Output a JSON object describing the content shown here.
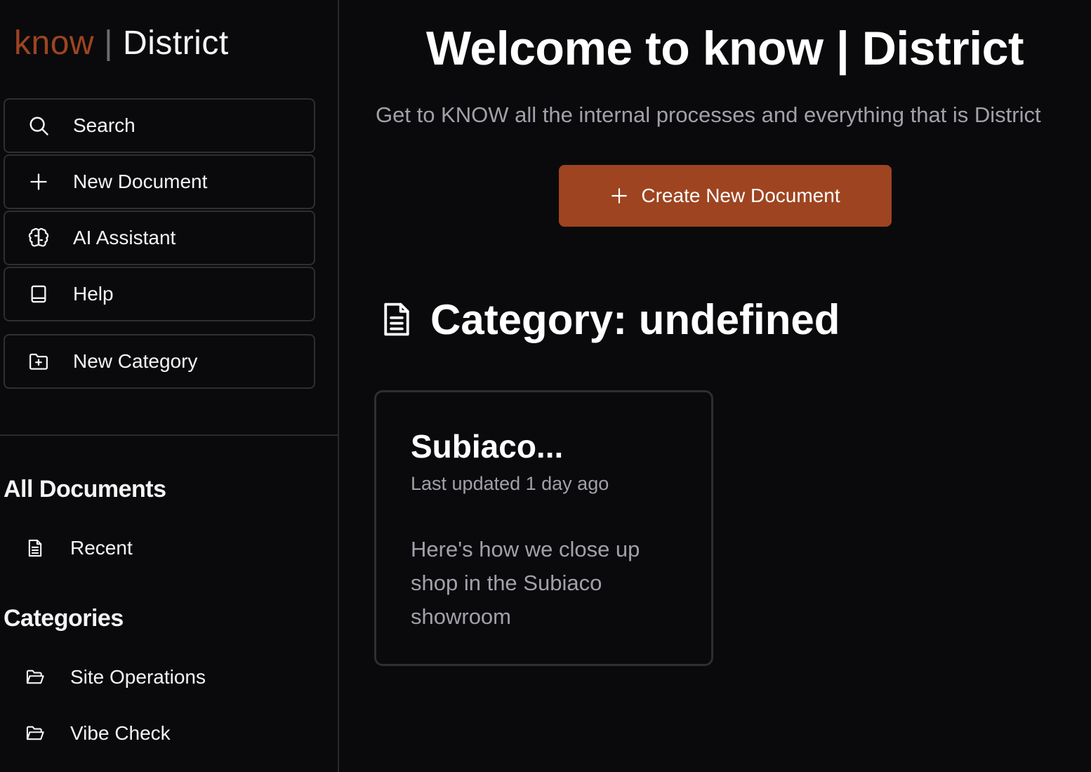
{
  "brand": {
    "know": "know",
    "separator": "|",
    "name": "District",
    "accent_color": "#9e4420"
  },
  "sidebar": {
    "actions": [
      {
        "label": "Search",
        "icon": "search-icon"
      },
      {
        "label": "New Document",
        "icon": "plus-icon"
      },
      {
        "label": "AI Assistant",
        "icon": "brain-icon"
      },
      {
        "label": "Help",
        "icon": "book-icon"
      },
      {
        "label": "New Category",
        "icon": "folder-plus-icon"
      }
    ],
    "all_documents": {
      "title": "All Documents",
      "items": [
        {
          "label": "Recent",
          "icon": "document-icon"
        }
      ]
    },
    "categories": {
      "title": "Categories",
      "items": [
        {
          "label": "Site Operations",
          "icon": "folder-open-icon"
        },
        {
          "label": "Vibe Check",
          "icon": "folder-open-icon"
        }
      ]
    }
  },
  "main": {
    "welcome": "Welcome to know | District",
    "subtitle": "Get to KNOW all the internal processes and everything that is District",
    "create_button": {
      "label": "Create New Document",
      "icon": "plus-icon"
    },
    "category_heading": "Category: undefined",
    "documents": [
      {
        "title": "Subiaco...",
        "updated": "Last updated 1 day ago",
        "description": "Here's how we close up shop in the Subiaco showroom"
      }
    ]
  }
}
